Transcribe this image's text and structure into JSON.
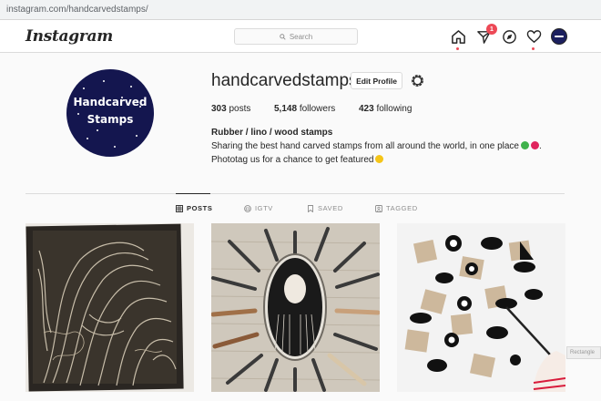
{
  "browser": {
    "url": "instagram.com/handcarvedstamps/"
  },
  "header": {
    "logo": "Instagram",
    "search_placeholder": "Search",
    "notifications_count": "1"
  },
  "profile": {
    "avatar_text_line1": "Handcarved",
    "avatar_text_line2": "Stamps",
    "username": "handcarvedstamps",
    "edit_profile_label": "Edit Profile",
    "posts_count": "303",
    "posts_label": "posts",
    "followers_count": "5,148",
    "followers_label": "followers",
    "following_count": "423",
    "following_label": "following",
    "full_name": "Rubber / lino / wood stamps",
    "bio_line1": "Sharing the best hand carved stamps from all around the world, in one place",
    "bio_line2": "Phototag us for a chance to get featured"
  },
  "tabs": [
    {
      "label": "POSTS",
      "icon": "grid-icon",
      "active": true
    },
    {
      "label": "IGTV",
      "icon": "igtv-icon",
      "active": false
    },
    {
      "label": "SAVED",
      "icon": "bookmark-icon",
      "active": false
    },
    {
      "label": "TAGGED",
      "icon": "tag-icon",
      "active": false
    }
  ],
  "posts": [
    {
      "subject": "lino print of horse"
    },
    {
      "subject": "carving tools around woman portrait stamp"
    },
    {
      "subject": "sushi stamps on paper"
    }
  ],
  "side_tab": "Rectangle",
  "colors": {
    "accent_red": "#ed4956",
    "avatar_navy": "#14164f",
    "border": "#dbdbdb",
    "text": "#262626",
    "muted": "#8e8e8e"
  }
}
